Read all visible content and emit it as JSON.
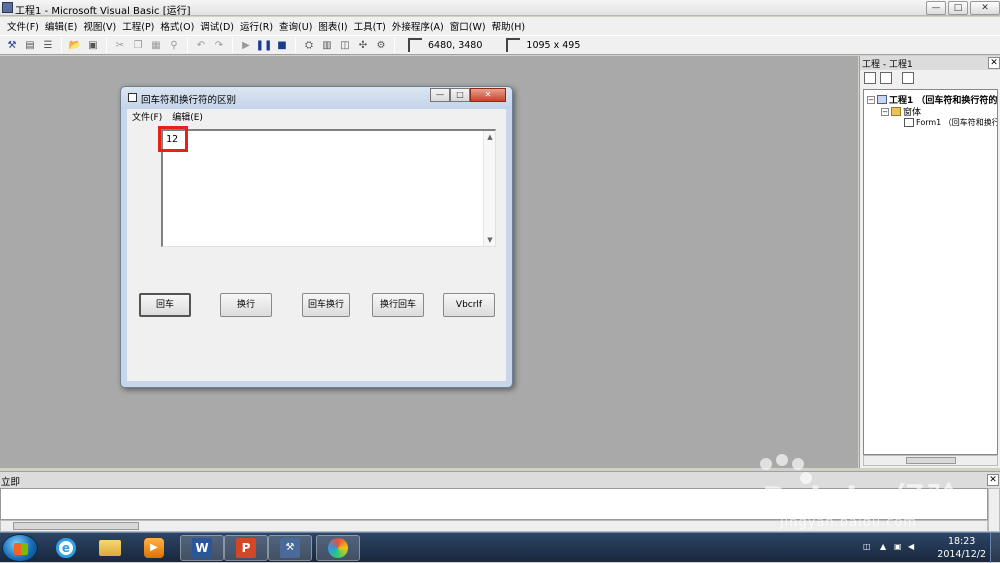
{
  "app": {
    "title": "工程1 - Microsoft Visual Basic [运行]",
    "window_buttons": [
      "—",
      "□",
      "✕"
    ]
  },
  "menubar": {
    "items": [
      "文件(F)",
      "编辑(E)",
      "视图(V)",
      "工程(P)",
      "格式(O)",
      "调试(D)",
      "运行(R)",
      "查询(U)",
      "图表(I)",
      "工具(T)",
      "外接程序(A)",
      "窗口(W)",
      "帮助(H)"
    ]
  },
  "toolbar": {
    "position_readout": "6480, 3480",
    "size_readout": "1095 x 495",
    "icons": [
      "add-project-icon",
      "add-form-icon",
      "menu-editor-icon",
      "open-icon",
      "save-icon",
      "cut-icon",
      "copy-icon",
      "paste-icon",
      "find-icon",
      "undo-icon",
      "redo-icon",
      "start-icon",
      "break-icon",
      "end-icon",
      "project-explorer-icon",
      "properties-icon",
      "form-layout-icon",
      "object-browser-icon",
      "toolbox-icon"
    ]
  },
  "form": {
    "title": "回车符和换行符的区别",
    "menus": [
      "文件(F)",
      "编辑(E)"
    ],
    "textbox_value": "12",
    "buttons": [
      "回车",
      "换行",
      "回车换行",
      "换行回车",
      "Vbcrlf"
    ]
  },
  "project_panel": {
    "title": "工程 - 工程1",
    "tree": {
      "project": "工程1 （回车符和换行符的",
      "folder": "窗体",
      "form": "Form1 （回车符和换行"
    }
  },
  "immediate": {
    "title": "立即"
  },
  "taskbar": {
    "time": "18:23",
    "date": "2014/12/2"
  },
  "watermark": {
    "brand": "Bai du 经验",
    "url": "jingyan.baidu.com"
  },
  "colors": {
    "mdi_background": "#a9a9a9",
    "highlight_border": "#e8201a",
    "taskbar": "#1f324d"
  }
}
